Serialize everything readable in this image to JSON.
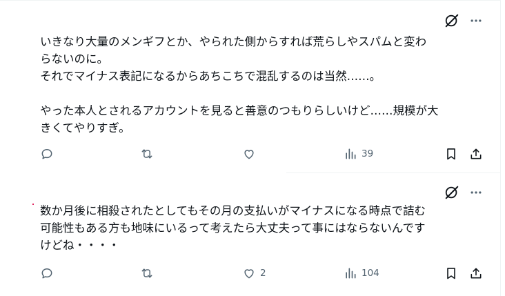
{
  "posts": [
    {
      "lines": [
        "いきなり大量のメンギフとか、やられた側からすれば荒らしやスパムと変わ",
        "らないのに。",
        "それでマイナス表記になるからあちこちで混乱するのは当然……。",
        "",
        "やった本人とされるアカウントを見ると善意のつもりらしいけど……規模が大",
        "きくてやりすぎ。"
      ],
      "likes": "",
      "views": "39"
    },
    {
      "lines": [
        "数か月後に相殺されたとしてもその月の支払いがマイナスになる時点で詰む",
        "可能性もある方も地味にいるって考えたら大丈夫って事にはならないんです",
        "けどね・・・・"
      ],
      "likes": "2",
      "views": "104"
    }
  ],
  "icons": {
    "grok": "grok-icon",
    "more": "more-icon",
    "reply": "reply-icon",
    "retweet": "retweet-icon",
    "like": "heart-icon",
    "views": "views-icon",
    "bookmark": "bookmark-icon",
    "share": "share-icon"
  },
  "colors": {
    "text": "#0f1419",
    "muted": "#536471",
    "border": "#eff3f4"
  }
}
